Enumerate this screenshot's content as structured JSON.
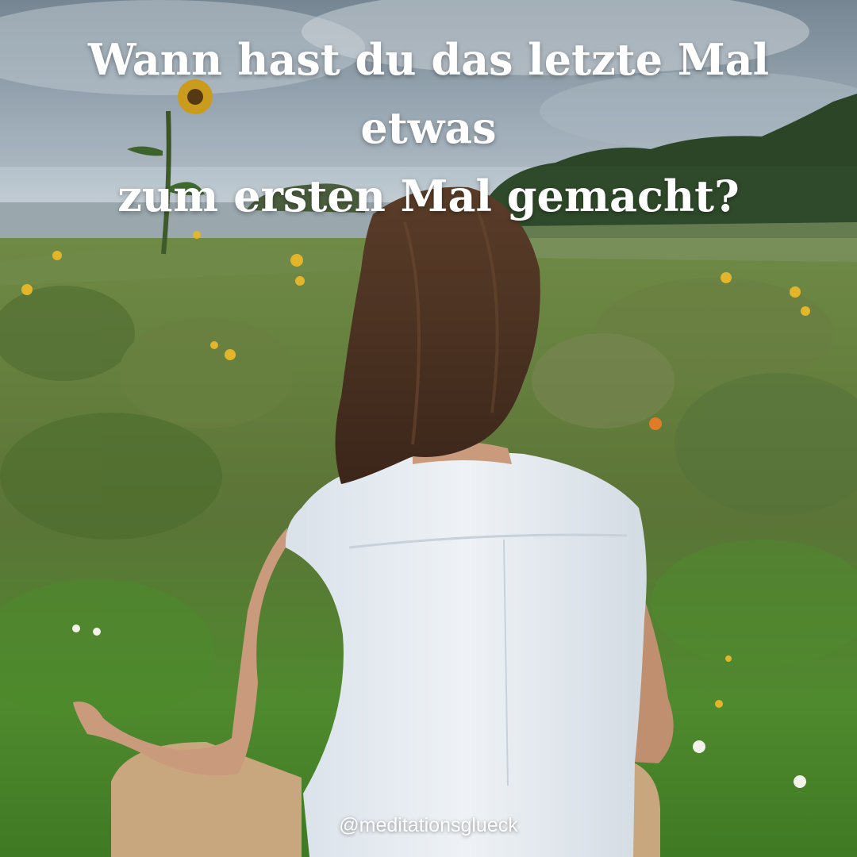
{
  "headline": {
    "line1": "Wann hast du das letzte Mal etwas",
    "line2": "zum ersten Mal gemacht?"
  },
  "handle": "@meditationsglueck",
  "colors": {
    "sky": "#a9b8c4",
    "water": "#9aa8ae",
    "trees": "#2f4a2a",
    "meadow": "#5f7d3c",
    "grass": "#4f8a2e",
    "hair": "#4a3222",
    "shirt": "#e9eef3",
    "skin": "#c99a7c",
    "pants": "#c9a77e",
    "text": "#ffffff"
  }
}
